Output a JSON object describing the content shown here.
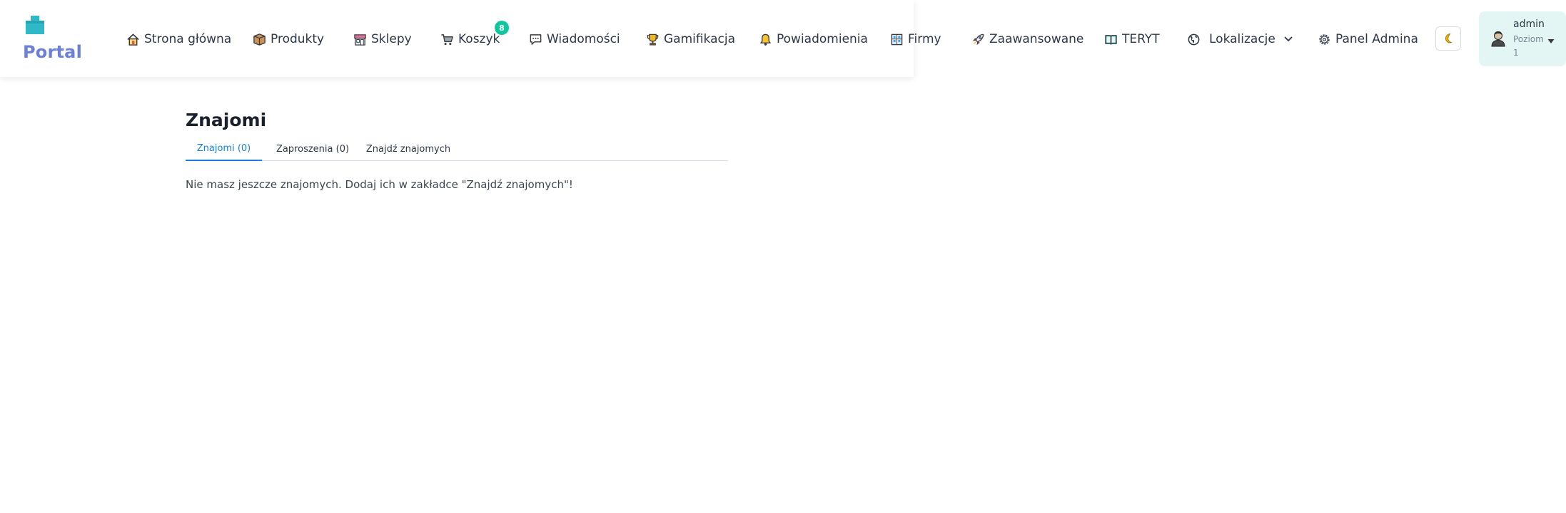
{
  "brand": {
    "name": "Portal",
    "icon": "portal-logo-icon",
    "color": "#6a7fdb",
    "icon_color": "#2eb8c8"
  },
  "nav": {
    "items": [
      {
        "label": "Strona główna",
        "icon": "home-icon"
      },
      {
        "label": "Produkty",
        "icon": "box-icon"
      },
      {
        "label": "Sklepy",
        "icon": "store-icon"
      },
      {
        "label": "Koszyk",
        "icon": "cart-icon",
        "badge": "8"
      },
      {
        "label": "Wiadomości",
        "icon": "chat-icon"
      },
      {
        "label": "Gamifikacja",
        "icon": "trophy-icon"
      },
      {
        "label": "Powiadomienia",
        "icon": "bell-icon"
      },
      {
        "label": "Firmy",
        "icon": "building-icon"
      },
      {
        "label": "Zaawansowane",
        "icon": "rocket-icon"
      },
      {
        "label": "TERYT",
        "icon": "book-icon"
      },
      {
        "label": "Lokalizacje",
        "icon": "globe-icon",
        "dropdown": true
      },
      {
        "label": "Panel Admina",
        "icon": "gear-icon"
      }
    ],
    "theme_toggle_icon": "moon-icon",
    "badge_color": "#10c8a0"
  },
  "user": {
    "name": "admin",
    "level_label": "Poziom",
    "level_value": "1",
    "icon": "user-avatar-icon",
    "background": "#e4f6f3"
  },
  "page": {
    "title": "Znajomi",
    "tabs": [
      {
        "label": "Znajomi (0)",
        "active": true
      },
      {
        "label": "Zaproszenia (0)",
        "active": false
      },
      {
        "label": "Znajdź znajomych",
        "active": false
      }
    ],
    "empty_message": "Nie masz jeszcze znajomych. Dodaj ich w zakładce \"Znajdź znajomych\"!",
    "accent_color": "#1b7fe0"
  }
}
